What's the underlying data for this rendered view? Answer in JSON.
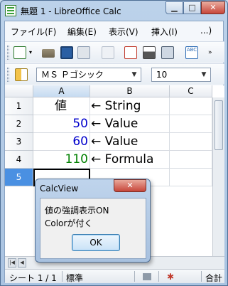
{
  "window": {
    "title": "無題 1 - LibreOffice Calc",
    "min_label": "▁",
    "max_label": "□",
    "close_label": "✕"
  },
  "menu": {
    "items": [
      "ファイル(F)",
      "編集(E)",
      "表示(V)",
      "挿入(I)",
      "...)"
    ]
  },
  "toolbar2": {
    "font_name": "ＭＳ Ｐゴシック",
    "font_size": "10",
    "dropdown_arrow": "▼"
  },
  "grid": {
    "columns": [
      "A",
      "B",
      "C"
    ],
    "rows": [
      "1",
      "2",
      "3",
      "4",
      "5"
    ],
    "cells": [
      {
        "a": "値",
        "b": "← String",
        "color": "#000000"
      },
      {
        "a": "50",
        "b": "← Value",
        "color": "#0000cc"
      },
      {
        "a": "60",
        "b": "← Value",
        "color": "#0000cc"
      },
      {
        "a": "110",
        "b": "← Formula",
        "color": "#008000"
      },
      {
        "a": "",
        "b": "",
        "color": "#000000"
      }
    ]
  },
  "tabbar": {
    "nav": [
      "|◀",
      "◀"
    ]
  },
  "status": {
    "sheet": "シート 1 / 1",
    "style": "標準",
    "sum_label": "合計"
  },
  "dialog": {
    "title": "CalcView",
    "close_label": "✕",
    "line1": "値の強調表示ON",
    "line2": "Colorが付く",
    "ok_label": "OK"
  },
  "colors": {
    "selection": "#4a90e2",
    "value_blue": "#0000cc",
    "formula_green": "#008000"
  }
}
